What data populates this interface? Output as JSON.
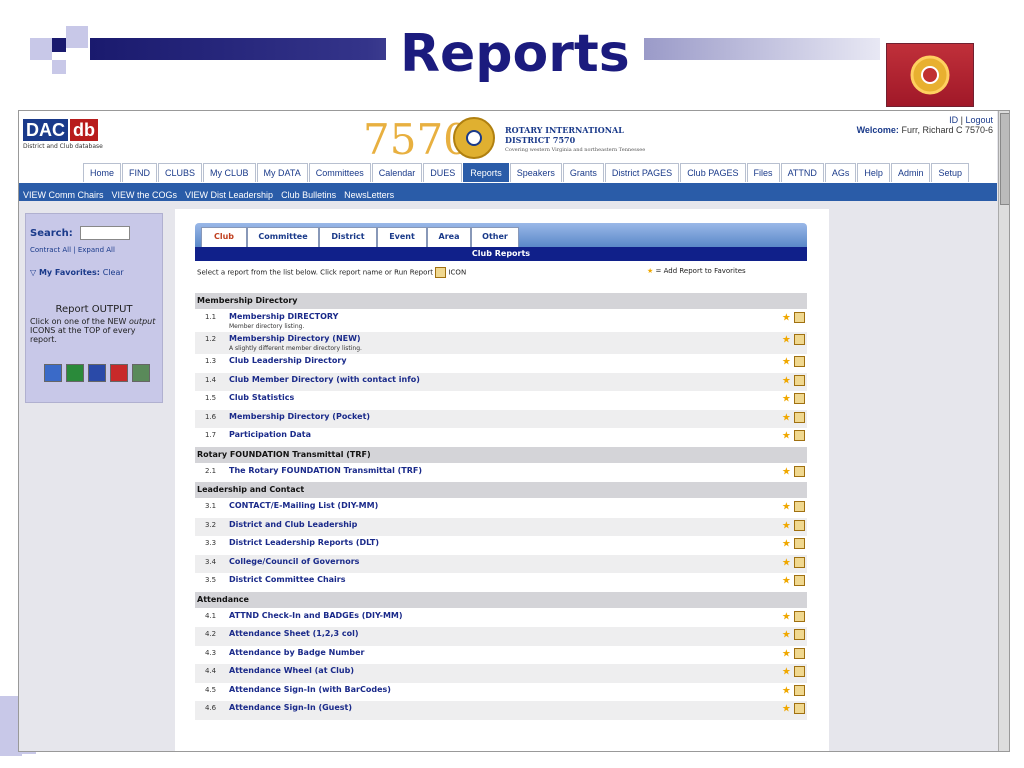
{
  "slide": {
    "title": "Reports"
  },
  "header": {
    "logo_a": "DAC",
    "logo_b": "db",
    "logo_sub": "District and Club database",
    "district_number": "7570",
    "ri_line1": "ROTARY INTERNATIONAL",
    "ri_line2": "DISTRICT 7570",
    "ri_line3": "Covering western Virginia and northeastern Tennessee",
    "id_link": "ID",
    "logout_link": "Logout",
    "welcome_label": "Welcome:",
    "welcome_name": "Furr, Richard C 7570-6"
  },
  "nav": [
    "Home",
    "FIND",
    "CLUBS",
    "My CLUB",
    "My DATA",
    "Committees",
    "Calendar",
    "DUES",
    "Reports",
    "Speakers",
    "Grants",
    "District PAGES",
    "Club PAGES",
    "Files",
    "ATTND",
    "AGs",
    "Help",
    "Admin",
    "Setup"
  ],
  "subnav": [
    "VIEW Comm Chairs",
    "VIEW the COGs",
    "VIEW Dist Leadership",
    "Club Bulletins",
    "NewsLetters"
  ],
  "left": {
    "search_label": "Search:",
    "contract_all": "Contract All",
    "expand_all": "Expand All",
    "favorites_label": "My Favorites:",
    "favorites_clear": "Clear",
    "output_title": "Report OUTPUT",
    "output_text_a": "Click on one of the NEW",
    "output_text_b": "output",
    "output_text_c": "ICONS at the TOP of every report."
  },
  "tabs": [
    "Club",
    "Committee",
    "District",
    "Event",
    "Area",
    "Other"
  ],
  "panel_title": "Club Reports",
  "instruction_a": "Select a report from the list below. Click report name or Run Report",
  "instruction_b": "ICON",
  "fav_note": "= Add Report to Favorites",
  "sections": [
    {
      "title": "Membership Directory",
      "rows": [
        {
          "num": "1.1",
          "name": "Membership DIRECTORY",
          "desc": "Member directory listing."
        },
        {
          "num": "1.2",
          "name": "Membership Directory (NEW)",
          "desc": "A slightly different member directory listing."
        },
        {
          "num": "1.3",
          "name": "Club Leadership Directory",
          "desc": ""
        },
        {
          "num": "1.4",
          "name": "Club Member Directory (with contact info)",
          "desc": ""
        },
        {
          "num": "1.5",
          "name": "Club Statistics",
          "desc": ""
        },
        {
          "num": "1.6",
          "name": "Membership Directory (Pocket)",
          "desc": ""
        },
        {
          "num": "1.7",
          "name": "Participation Data",
          "desc": ""
        }
      ]
    },
    {
      "title": "Rotary FOUNDATION Transmittal (TRF)",
      "rows": [
        {
          "num": "2.1",
          "name": "The Rotary FOUNDATION Transmittal (TRF)",
          "desc": ""
        }
      ]
    },
    {
      "title": "Leadership and Contact",
      "rows": [
        {
          "num": "3.1",
          "name": "CONTACT/E-Mailing List (DIY-MM)",
          "desc": ""
        },
        {
          "num": "3.2",
          "name": "District and Club Leadership",
          "desc": ""
        },
        {
          "num": "3.3",
          "name": "District Leadership Reports (DLT)",
          "desc": ""
        },
        {
          "num": "3.4",
          "name": "College/Council of Governors",
          "desc": ""
        },
        {
          "num": "3.5",
          "name": "District Committee Chairs",
          "desc": ""
        }
      ]
    },
    {
      "title": "Attendance",
      "rows": [
        {
          "num": "4.1",
          "name": "ATTND Check-In and BADGEs (DIY-MM)",
          "desc": ""
        },
        {
          "num": "4.2",
          "name": "Attendance Sheet (1,2,3 col)",
          "desc": ""
        },
        {
          "num": "4.3",
          "name": "Attendance by Badge Number",
          "desc": ""
        },
        {
          "num": "4.4",
          "name": "Attendance Wheel (at Club)",
          "desc": ""
        },
        {
          "num": "4.5",
          "name": "Attendance Sign-In (with BarCodes)",
          "desc": ""
        },
        {
          "num": "4.6",
          "name": "Attendance Sign-In (Guest)",
          "desc": ""
        }
      ]
    }
  ]
}
